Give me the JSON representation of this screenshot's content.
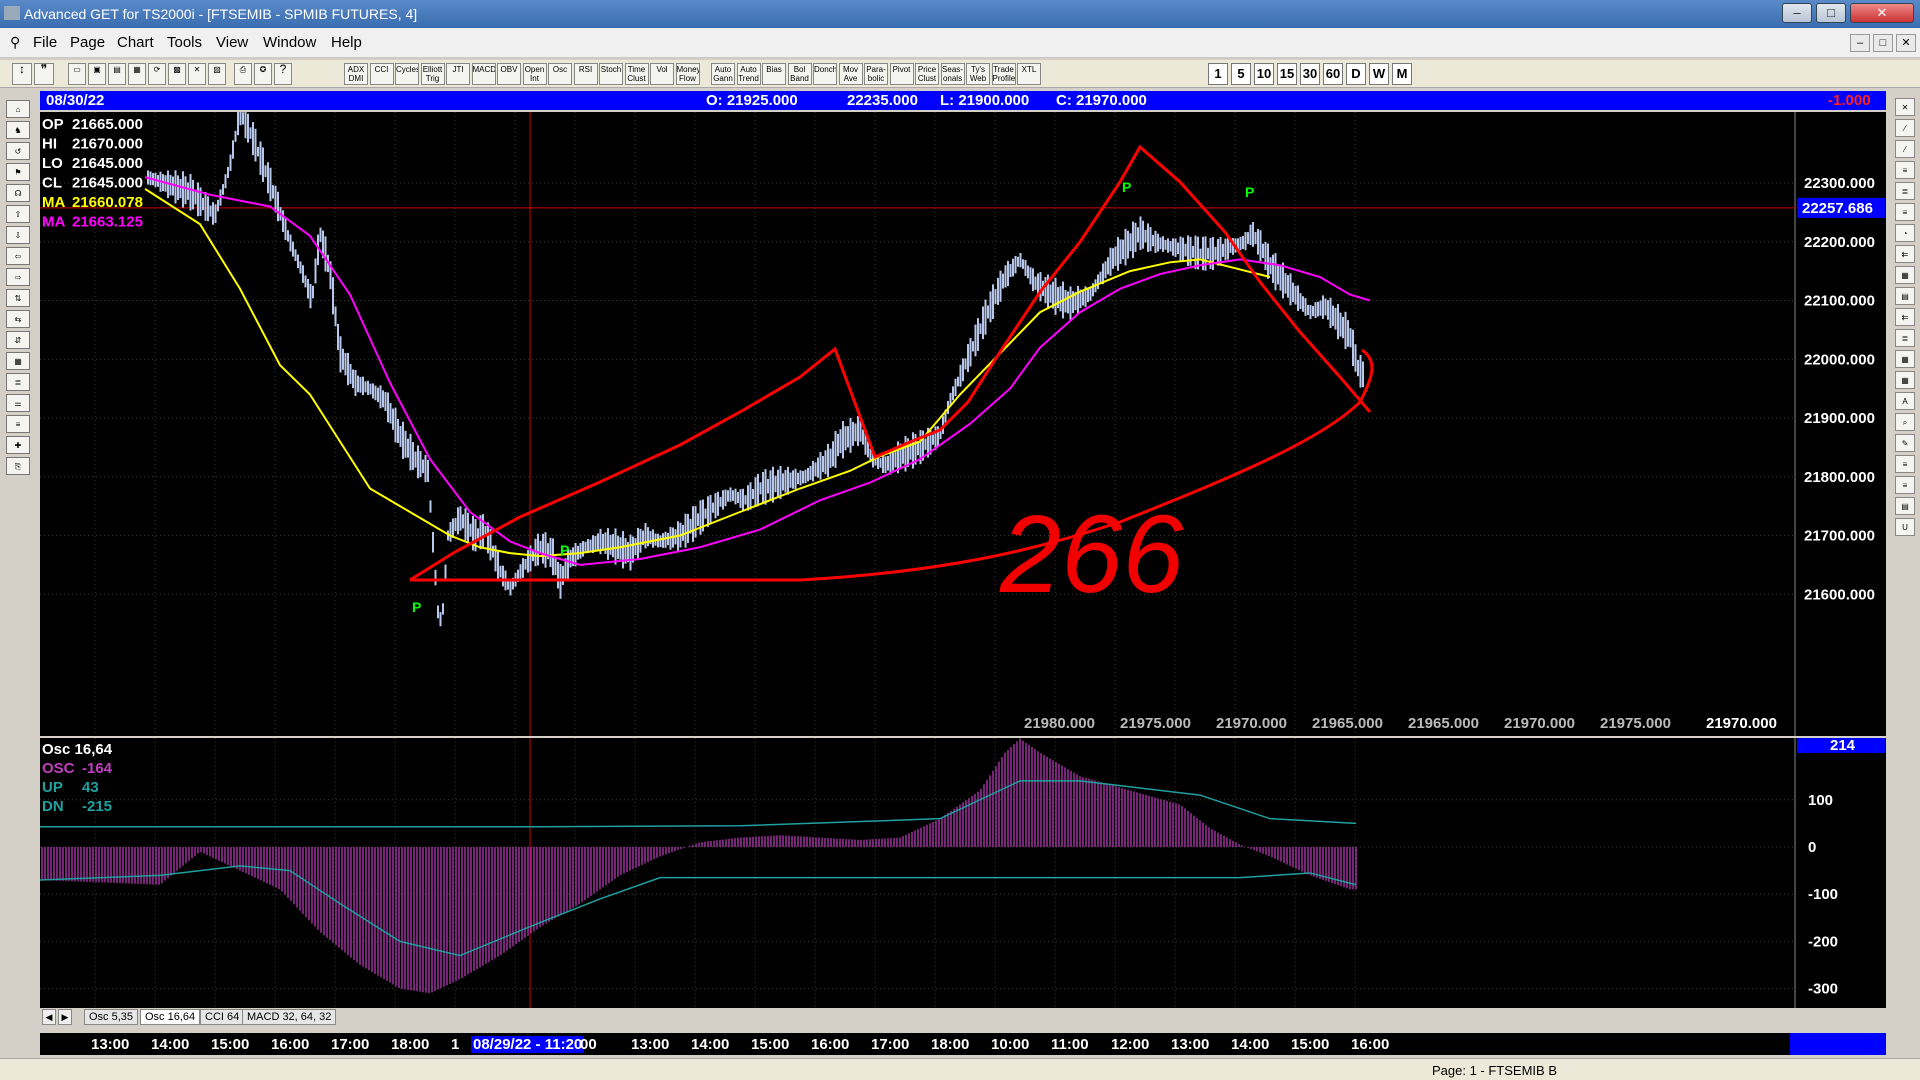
{
  "window": {
    "title": "Advanced GET for TS2000i - [FTSEMIB - SPMIB FUTURES, 4]",
    "min": "–",
    "max": "□",
    "close": "✕"
  },
  "menu": [
    "File",
    "Page",
    "Chart",
    "Tools",
    "View",
    "Window",
    "Help"
  ],
  "mdi": [
    "–",
    "□",
    "✕"
  ],
  "toolbar": {
    "studies": [
      "ADX DMI",
      "CCI",
      "Cycles",
      "Elliott Trig",
      "JTI",
      "MACD",
      "OBV",
      "Open Int",
      "Osc",
      "RSI",
      "Stoch",
      "Time Clust",
      "Vol",
      "Money Flow",
      "Auto Gann",
      "Auto Trend",
      "Bias",
      "Bol Band",
      "Donch",
      "Mov Ave",
      "Para-bolic",
      "Pivot",
      "Price Clust",
      "Seas-onals",
      "Ty's Web",
      "Trade Profile",
      "XTL"
    ],
    "intervals": [
      "1",
      "5",
      "10",
      "15",
      "30",
      "60",
      "D",
      "W",
      "M"
    ]
  },
  "info": {
    "date": "08/30/22",
    "open": "O: 21925.000",
    "high": "22235.000",
    "low": "L: 21900.000",
    "close": "C: 21970.000",
    "change": "-1.000"
  },
  "legend": [
    {
      "label": "OP",
      "value": "21665.000",
      "color": "#ffffff"
    },
    {
      "label": "HI",
      "value": "21670.000",
      "color": "#ffffff"
    },
    {
      "label": "LO",
      "value": "21645.000",
      "color": "#ffffff"
    },
    {
      "label": "CL",
      "value": "21645.000",
      "color": "#ffffff"
    },
    {
      "label": "MA",
      "value": "21660.078",
      "color": "#ffff00"
    },
    {
      "label": "MA",
      "value": "21663.125",
      "color": "#ff00ff"
    }
  ],
  "price_axis": [
    "22300.000",
    "22200.000",
    "22100.000",
    "22000.000",
    "21900.000",
    "21800.000",
    "21700.000",
    "21600.000"
  ],
  "price_marker": "22257.686",
  "bottom_values": [
    "21980.000",
    "21975.000",
    "21970.000",
    "21965.000",
    "21965.000",
    "21970.000",
    "21975.000",
    "21970.000"
  ],
  "pivots": [
    "P",
    "P",
    "P",
    "P"
  ],
  "annotation": "266",
  "osc": {
    "title": "Osc 16,64",
    "legend": [
      {
        "label": "OSC",
        "value": "-164",
        "color": "#c040c0"
      },
      {
        "label": "UP",
        "value": "43",
        "color": "#20a0a0"
      },
      {
        "label": "DN",
        "value": "-215",
        "color": "#20a0a0"
      }
    ],
    "axis": [
      "100",
      "0",
      "-100",
      "-200",
      "-300"
    ],
    "marker": "214"
  },
  "tabs": [
    "Osc 5,35",
    "Osc 16,64",
    "CCI 64",
    "MACD 32, 64, 32"
  ],
  "time_axis": [
    "13:00",
    "14:00",
    "15:00",
    "16:00",
    "17:00",
    "18:00",
    "1",
    "08/29/22 - 11:20",
    "00",
    "13:00",
    "14:00",
    "15:00",
    "16:00",
    "17:00",
    "18:00",
    "10:00",
    "11:00",
    "12:00",
    "13:00",
    "14:00",
    "15:00",
    "16:00"
  ],
  "status": "Page: 1 - FTSEMIB B",
  "colors": {
    "ma_fast": "#ffff00",
    "ma_slow": "#ff00ff",
    "drawing": "#ff0000",
    "bars": "#b8c8ec",
    "pivot": "#00ff00",
    "osc_hist": "#a030a0",
    "osc_line": "#20a0a0",
    "info_bg": "#0000ff"
  }
}
